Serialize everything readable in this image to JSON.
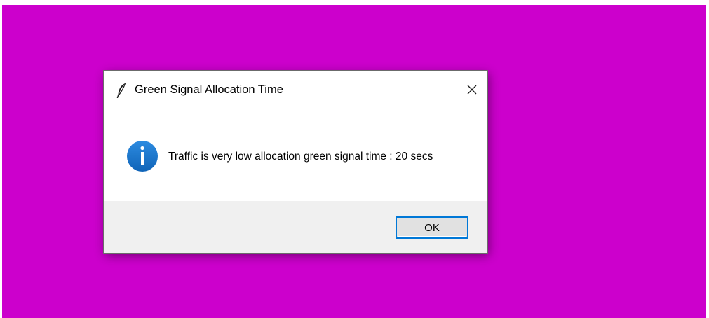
{
  "dialog": {
    "title": "Green Signal Allocation Time",
    "message": "Traffic is very low allocation green signal time : 20 secs",
    "ok_label": "OK",
    "icons": {
      "app": "feather-icon",
      "type": "info-icon",
      "close": "close-icon"
    }
  },
  "colors": {
    "desktop_background": "#cc00cc",
    "dialog_background": "#ffffff",
    "footer_background": "#f0f0f0",
    "info_icon": "#1a74c9",
    "button_focus_border": "#0078d7"
  }
}
